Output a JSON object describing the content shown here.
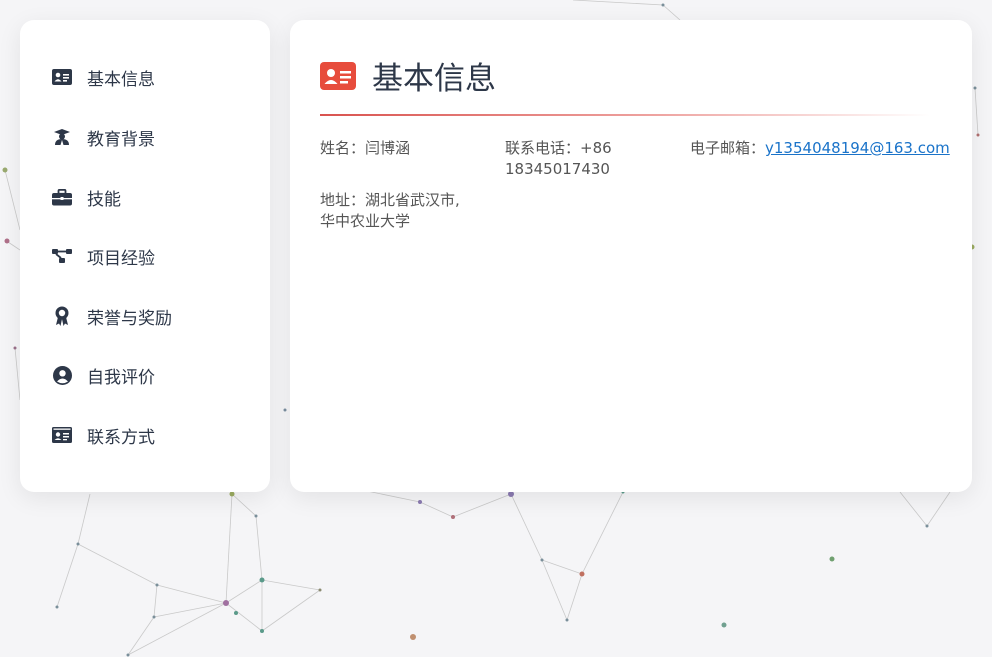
{
  "sidebar": {
    "items": [
      {
        "label": "基本信息",
        "icon": "id-card-icon"
      },
      {
        "label": "教育背景",
        "icon": "graduate-icon"
      },
      {
        "label": "技能",
        "icon": "briefcase-icon"
      },
      {
        "label": "项目经验",
        "icon": "project-diagram-icon"
      },
      {
        "label": "荣誉与奖励",
        "icon": "award-icon"
      },
      {
        "label": "自我评价",
        "icon": "user-circle-icon"
      },
      {
        "label": "联系方式",
        "icon": "contact-card-icon"
      }
    ]
  },
  "main": {
    "title": "基本信息",
    "title_icon": "id-card-icon",
    "accent_color": "#e74c3c",
    "fields": {
      "name": "姓名：闫博涵",
      "phone": "联系电话：+86 18345017430",
      "email_label": "电子邮箱：",
      "email": "y1354048194@163.com",
      "address_line1": "地址：湖北省武汉市,",
      "address_line2": "华中农业大学"
    }
  }
}
